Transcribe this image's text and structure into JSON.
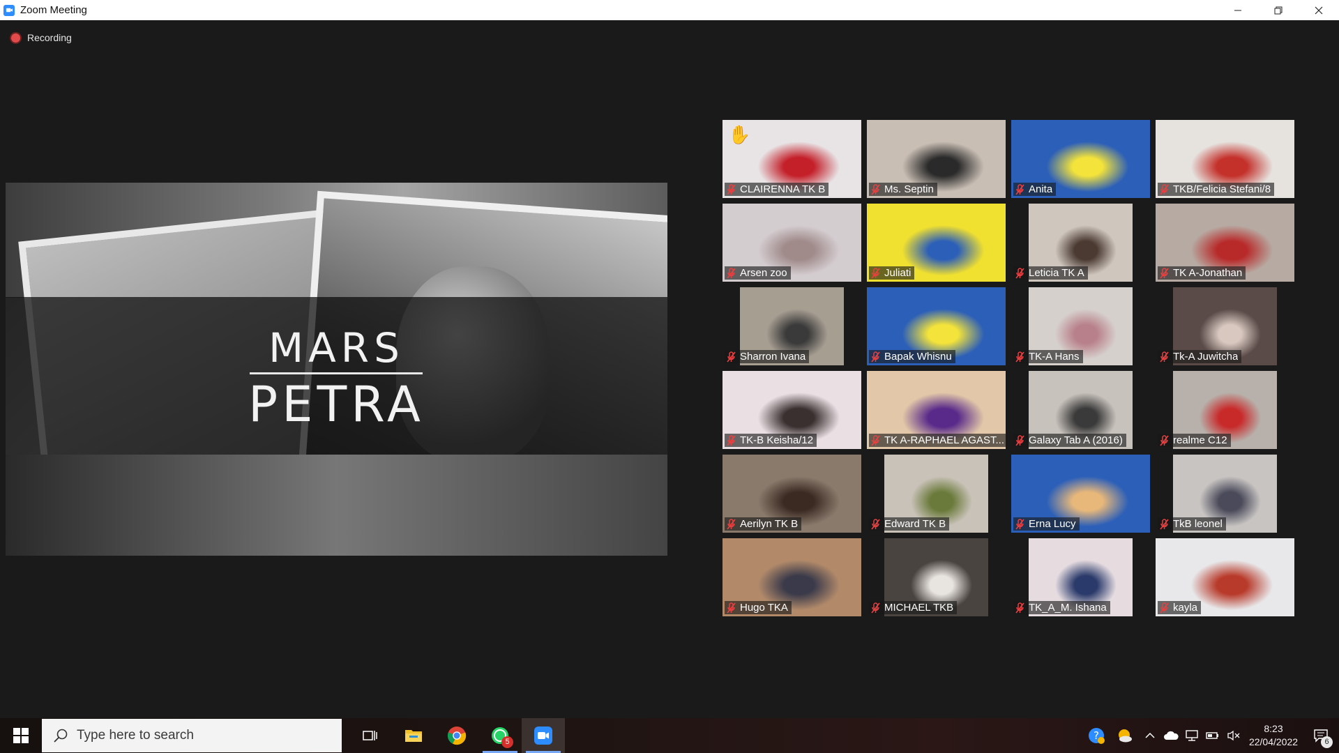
{
  "window": {
    "title": "Zoom Meeting"
  },
  "recording": {
    "label": "Recording"
  },
  "shared_screen": {
    "title": "MARS",
    "subtitle": "PETRA"
  },
  "participants": [
    {
      "name": "CLAIRENNA TK B",
      "bg": "#e8e4e6",
      "fg": "#c4202a",
      "hand": true
    },
    {
      "name": "Ms. Septin",
      "bg": "#c9beb4",
      "fg": "#2a2a2a",
      "hand": false
    },
    {
      "name": "Anita",
      "bg": "#2c5fb8",
      "fg": "#f3e33a",
      "hand": false
    },
    {
      "name": "TKB/Felicia Stefani/8",
      "bg": "#e6e2de",
      "fg": "#c4302a",
      "hand": false
    },
    {
      "name": "Arsen zoo",
      "bg": "#d4cdd0",
      "fg": "#a08a8a",
      "hand": false
    },
    {
      "name": "Juliati",
      "bg": "#f0e030",
      "fg": "#2c5fb8",
      "hand": false
    },
    {
      "name": "Leticia TK A",
      "bg": "#cfc6be",
      "fg": "#4a3a32",
      "hand": false
    },
    {
      "name": "TK A-Jonathan",
      "bg": "#b7aaa2",
      "fg": "#b82a2a",
      "hand": false
    },
    {
      "name": "Sharron Ivana",
      "bg": "#a79e92",
      "fg": "#3a3a3a",
      "hand": false
    },
    {
      "name": "Bapak Whisnu",
      "bg": "#2c5fb8",
      "fg": "#f3e33a",
      "hand": false
    },
    {
      "name": "TK-A Hans",
      "bg": "#d6d0cc",
      "fg": "#b8808a",
      "hand": false
    },
    {
      "name": "Tk-A Juwitcha",
      "bg": "#5a4a48",
      "fg": "#d8c8c0",
      "hand": false
    },
    {
      "name": "TK-B Keisha/12",
      "bg": "#eadfe3",
      "fg": "#3a3030",
      "hand": false
    },
    {
      "name": "TK A-RAPHAEL AGAST...",
      "bg": "#e2c8a8",
      "fg": "#5a2a8a",
      "hand": false
    },
    {
      "name": "Galaxy Tab A (2016)",
      "bg": "#c8c2bc",
      "fg": "#3a3a3a",
      "hand": false
    },
    {
      "name": "realme C12",
      "bg": "#b8b0aa",
      "fg": "#c82a2a",
      "hand": false
    },
    {
      "name": "Aerilyn TK B",
      "bg": "#8a7a6c",
      "fg": "#3a2a22",
      "hand": false
    },
    {
      "name": "Edward TK B",
      "bg": "#c9c2b8",
      "fg": "#6a7a3a",
      "hand": false
    },
    {
      "name": "Erna Lucy",
      "bg": "#2c5fb8",
      "fg": "#e8b87a",
      "hand": false
    },
    {
      "name": "TkB leonel",
      "bg": "#c8c4c2",
      "fg": "#4a4a5a",
      "hand": false
    },
    {
      "name": "Hugo TKA",
      "bg": "#b28a6a",
      "fg": "#3a3a4a",
      "hand": false
    },
    {
      "name": "MICHAEL TKB",
      "bg": "#4a4440",
      "fg": "#e8e4e0",
      "hand": false
    },
    {
      "name": "TK_A_M. Ishana",
      "bg": "#e6dce0",
      "fg": "#2a3a6a",
      "hand": false
    },
    {
      "name": "kayla",
      "bg": "#e8e8ea",
      "fg": "#b83a2a",
      "hand": false
    }
  ],
  "taskbar": {
    "search_placeholder": "Type here to search",
    "whatsapp_badge": "5",
    "time": "8:23",
    "date": "22/04/2022",
    "notification_count": "6"
  }
}
